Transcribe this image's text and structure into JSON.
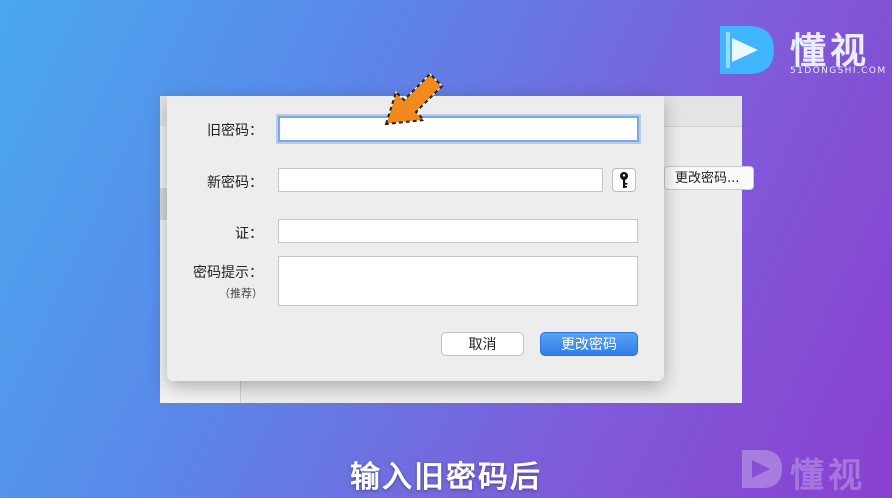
{
  "logo": {
    "text": "懂视",
    "sub": "51DONGSHI.COM"
  },
  "watermark": {
    "text": "懂视"
  },
  "background_window": {
    "button_label": "更改密码..."
  },
  "dialog": {
    "old_password_label": "旧密码：",
    "old_password_value": "",
    "new_password_label": "新密码：",
    "new_password_value": "",
    "verify_label": "证：",
    "verify_value": "",
    "hint_label": "密码提示：",
    "hint_sub_label": "（推荐）",
    "hint_value": "",
    "cancel_label": "取消",
    "change_label": "更改密码"
  },
  "caption": "输入旧密码后",
  "colors": {
    "accent": "#2f7fe8",
    "arrow": "#f08a1c",
    "focus_ring": "#7aa7e6"
  },
  "icons": {
    "key_button": "key-icon",
    "pointer": "orange-arrow-icon"
  }
}
